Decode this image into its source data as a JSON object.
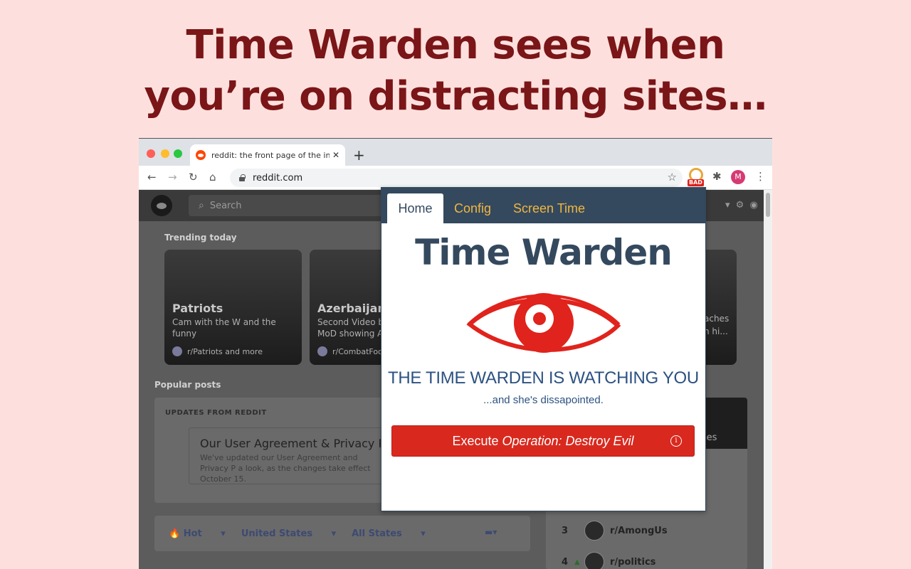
{
  "headline": {
    "line1": "Time Warden sees when",
    "line2": "you’re on distracting sites…"
  },
  "browser": {
    "tab_title": "reddit: the front page of the internet",
    "tab_close": "✕",
    "new_tab": "+",
    "url": "reddit.com",
    "extension_badge": "BAD",
    "profile_initial": "M"
  },
  "reddit": {
    "search_placeholder": "Search",
    "trending_label": "Trending today",
    "cards": [
      {
        "title": "Patriots",
        "subtitle": "Cam with the W and the",
        "subtitle2": "funny",
        "footer": "r/Patriots and more"
      },
      {
        "title": "Azerbaijan",
        "subtitle": "Second Video b",
        "subtitle2": "MoD showing A",
        "footer": "r/CombatFoot"
      }
    ],
    "card_fragment_1": "aches",
    "card_fragment_2": "n hi...",
    "popular_label": "Popular posts",
    "updates_header": "UPDATES FROM REDDIT",
    "updates_title": "Our User Agreement & Privacy Pol",
    "updates_text": "We've updated our User Agreement and Privacy P a look, as the changes take effect October 15.",
    "sort": {
      "hot": "Hot",
      "region": "United States",
      "states": "All States"
    },
    "right_fragment": "ies",
    "ranks": [
      {
        "num": "3",
        "name": "r/AmongUs",
        "trend": ""
      },
      {
        "num": "4",
        "name": "r/politics",
        "trend": "▲"
      }
    ]
  },
  "popup": {
    "tabs": {
      "home": "Home",
      "config": "Config",
      "screen_time": "Screen Time"
    },
    "title": "Time Warden",
    "watching": "THE TIME WARDEN IS WATCHING YOU",
    "disappointed": "...and she's dissapointed.",
    "button_prefix": "Execute",
    "button_operation": "Operation: Destroy Evil",
    "info_glyph": "i",
    "eye_color": "#e0231c"
  }
}
